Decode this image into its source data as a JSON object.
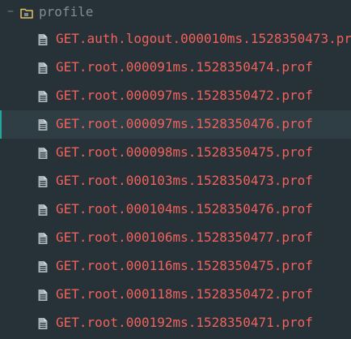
{
  "tree": {
    "folder": {
      "name": "profile",
      "toggle_glyph": "−",
      "icon": "folder-icon",
      "expanded": true
    },
    "file_icon": "file-icon",
    "colors": {
      "background": "#263238",
      "file_text": "#f0625c",
      "folder_text": "#7d8d96",
      "selection_background": "#2f3d44",
      "selection_accent": "#26a69a",
      "folder_icon_accent": "#e6c35c"
    },
    "selected_index": 3,
    "files": [
      {
        "name": "GET.auth.logout.000010ms.1528350473.prof"
      },
      {
        "name": "GET.root.000091ms.1528350474.prof"
      },
      {
        "name": "GET.root.000097ms.1528350472.prof"
      },
      {
        "name": "GET.root.000097ms.1528350476.prof"
      },
      {
        "name": "GET.root.000098ms.1528350475.prof"
      },
      {
        "name": "GET.root.000103ms.1528350473.prof"
      },
      {
        "name": "GET.root.000104ms.1528350476.prof"
      },
      {
        "name": "GET.root.000106ms.1528350477.prof"
      },
      {
        "name": "GET.root.000116ms.1528350475.prof"
      },
      {
        "name": "GET.root.000118ms.1528350472.prof"
      },
      {
        "name": "GET.root.000192ms.1528350471.prof"
      }
    ]
  }
}
